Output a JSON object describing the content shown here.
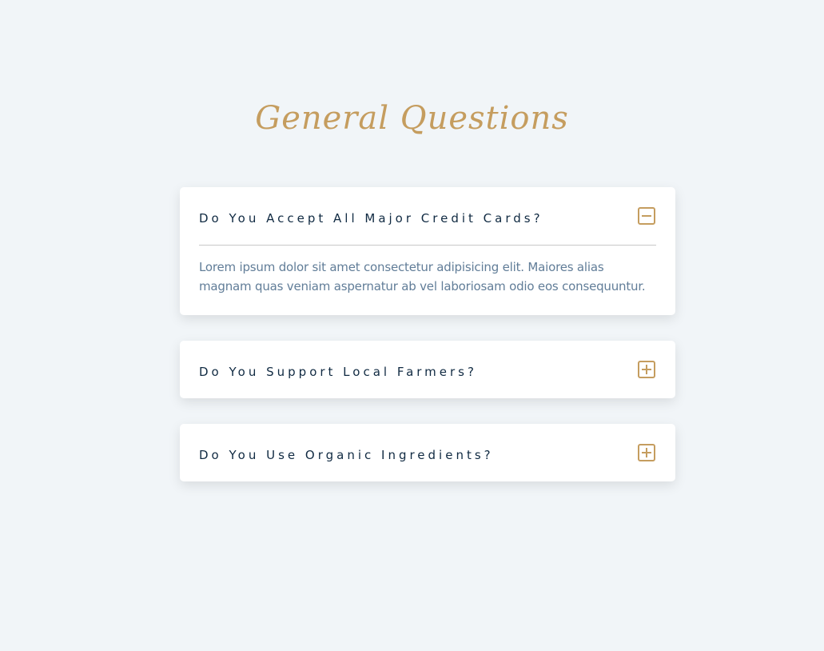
{
  "page": {
    "title": "General Questions"
  },
  "colors": {
    "background": "#f1f5f8",
    "accent": "#c59d5f",
    "question_text": "#102a42",
    "answer_text": "#617d98",
    "card": "#ffffff"
  },
  "faqs": [
    {
      "question": "Do You Accept All Major Credit Cards?",
      "answer": "Lorem ipsum dolor sit amet consectetur adipisicing elit. Maiores alias magnam quas veniam aspernatur ab vel laboriosam odio eos consequuntur.",
      "expanded": true,
      "toggle_icon": "minus-square-icon"
    },
    {
      "question": "Do You Support Local Farmers?",
      "expanded": false,
      "toggle_icon": "plus-square-icon"
    },
    {
      "question": "Do You Use Organic Ingredients?",
      "expanded": false,
      "toggle_icon": "plus-square-icon"
    }
  ]
}
